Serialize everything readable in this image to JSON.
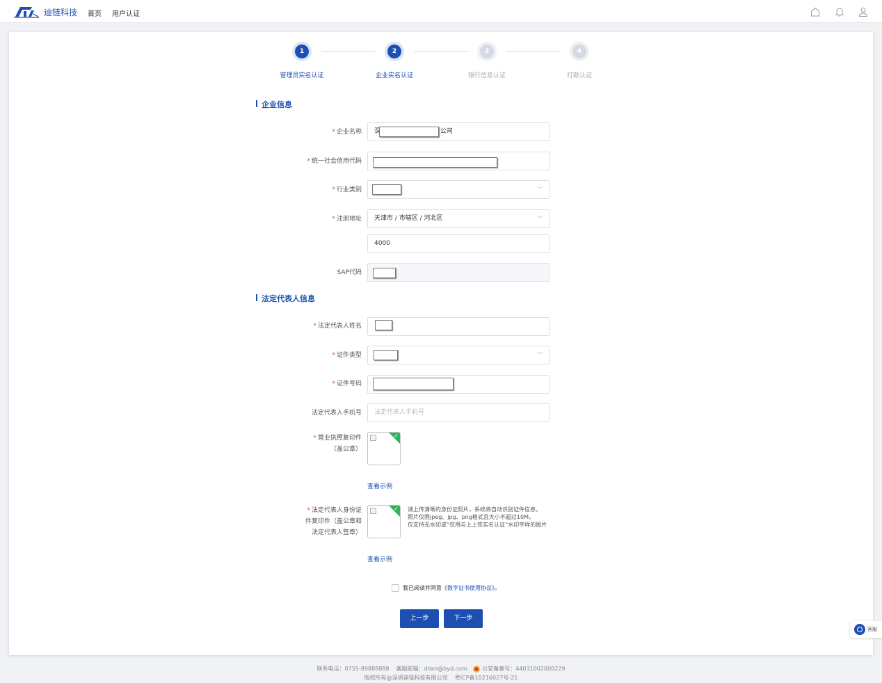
{
  "header": {
    "brand": "迪链科技",
    "nav": [
      "首页",
      "用户认证"
    ],
    "icons": [
      "home-icon",
      "bell-icon",
      "user-icon"
    ],
    "colors": {
      "primary": "#1d4fb2"
    }
  },
  "steps": [
    {
      "num": "1",
      "label": "管理员实名认证",
      "state": "done"
    },
    {
      "num": "2",
      "label": "企业实名认证",
      "state": "active"
    },
    {
      "num": "3",
      "label": "银行信息认证",
      "state": "todo"
    },
    {
      "num": "4",
      "label": "打款认证",
      "state": "todo"
    }
  ],
  "company": {
    "section_title": "企业信息",
    "name_label": "企业名称",
    "name_prefix": "深",
    "name_suffix": "公司",
    "credit_label": "统一社会信用代码",
    "industry_label": "行业类别",
    "address_label": "注册地址",
    "address_value": "天津市 / 市辖区 / 河北区",
    "address_detail": "4000",
    "sap_label": "SAP代码"
  },
  "legal": {
    "section_title": "法定代表人信息",
    "name_label": "法定代表人姓名",
    "id_type_label": "证件类型",
    "id_no_label": "证件号码",
    "phone_label": "法定代表人手机号",
    "phone_placeholder": "法定代表人手机号",
    "license_label_1": "营业执照复印件",
    "license_label_2": "（盖公章）",
    "example_link": "查看示例",
    "id_copy_label_1": "法定代表人身份证",
    "id_copy_label_2": "件复印件（盖公章和",
    "id_copy_label_3": "法定代表人签章）",
    "hint_1": "请上传清晰的身份证照片，系统将自动识别证件信息。",
    "hint_2": "照片仅限jpeg、jpg、png格式且大小不超过10M。",
    "hint_3": "仅支持无水印或“仅用与上上签实名认证”水印字样的图片"
  },
  "agreement": {
    "text": "我已阅读并同意",
    "link": "《数字证书使用协议》",
    "end": "。"
  },
  "buttons": {
    "prev": "上一步",
    "next": "下一步"
  },
  "service": {
    "label": "客服"
  },
  "footer": {
    "phone": "联系电话：0755-89888888",
    "email": "客服邮箱：dlian@byd.com",
    "police": "公安备案号：44031002000229",
    "copyright": "版权所有@深圳迪链科技有限公司",
    "icp": "粤ICP备10216027号-21"
  }
}
